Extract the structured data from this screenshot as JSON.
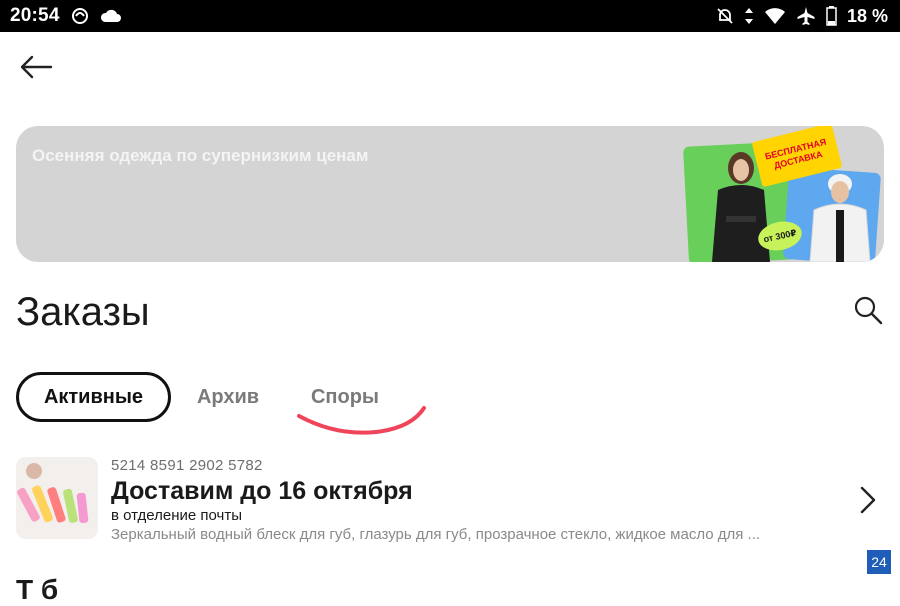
{
  "status_bar": {
    "time": "20:54",
    "battery": "18 %",
    "icons": [
      "sync-icon",
      "cloud-icon",
      "mute-icon",
      "data-arrows-icon",
      "wifi-icon",
      "airplane-icon",
      "battery-icon"
    ]
  },
  "banner": {
    "text": "Осенняя одежда по супернизким ценам",
    "sticker_line1": "БЕСПЛАТНАЯ",
    "sticker_line2": "ДОСТАВКА",
    "price_badge": "от 300₽",
    "colors": {
      "background": "#d4d4d4",
      "green": "#67cf5a",
      "blue": "#5ea8ef",
      "sticker": "#ffd400"
    }
  },
  "page": {
    "title": "Заказы"
  },
  "tabs": [
    {
      "label": "Активные",
      "selected": true
    },
    {
      "label": "Архив",
      "selected": false
    },
    {
      "label": "Споры",
      "selected": false
    }
  ],
  "order": {
    "number": "5214 8591 2902 5782",
    "status": "Доставим до 16 октября",
    "delivery": "в отделение почты",
    "description": "Зеркальный водный блеск для губ, глазурь для губ, прозрачное стекло, жидкое масло для ..."
  },
  "watermark": "24",
  "next_section_heading": "Т б"
}
